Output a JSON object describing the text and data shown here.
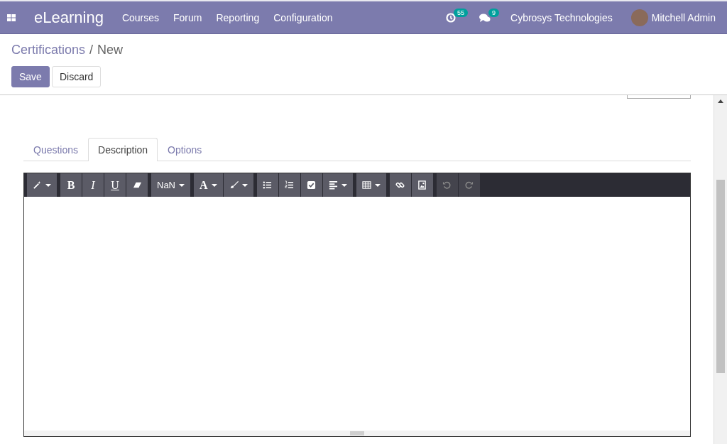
{
  "navbar": {
    "app_name": "eLearning",
    "menu": [
      "Courses",
      "Forum",
      "Reporting",
      "Configuration"
    ],
    "activity_count": "55",
    "message_count": "9",
    "company": "Cybrosys Technologies",
    "user": "Mitchell Admin"
  },
  "breadcrumb": {
    "parent": "Certifications",
    "separator": "/",
    "current": "New"
  },
  "actions": [
    {
      "label": "Save",
      "primary": true
    },
    {
      "label": "Discard",
      "primary": false
    }
  ],
  "tabs": [
    {
      "label": "Questions",
      "selected": false
    },
    {
      "label": "Description",
      "selected": true
    },
    {
      "label": "Options",
      "selected": false
    }
  ],
  "toolbar": [
    [
      {
        "kind": "wand",
        "disabled": false
      }
    ],
    [
      {
        "kind": "bold",
        "label": "B",
        "disabled": false
      },
      {
        "kind": "italic",
        "label": "I",
        "disabled": false
      },
      {
        "kind": "underline",
        "label": "U",
        "disabled": false
      },
      {
        "kind": "eraser",
        "disabled": false
      }
    ],
    [
      {
        "kind": "text",
        "label": "NaN",
        "disabled": false
      }
    ],
    [
      {
        "kind": "serif",
        "label": "A",
        "disabled": false
      },
      {
        "kind": "brush",
        "disabled": false
      }
    ],
    [
      {
        "kind": "list",
        "disabled": false
      },
      {
        "kind": "numlist",
        "disabled": false
      },
      {
        "kind": "checklist",
        "disabled": false
      },
      {
        "kind": "align",
        "disabled": false
      }
    ],
    [
      {
        "kind": "table",
        "disabled": false
      }
    ],
    [
      {
        "kind": "link",
        "disabled": false
      },
      {
        "kind": "image",
        "disabled": false
      }
    ],
    [
      {
        "kind": "undo",
        "disabled": true
      },
      {
        "kind": "redo",
        "disabled": true
      }
    ]
  ]
}
